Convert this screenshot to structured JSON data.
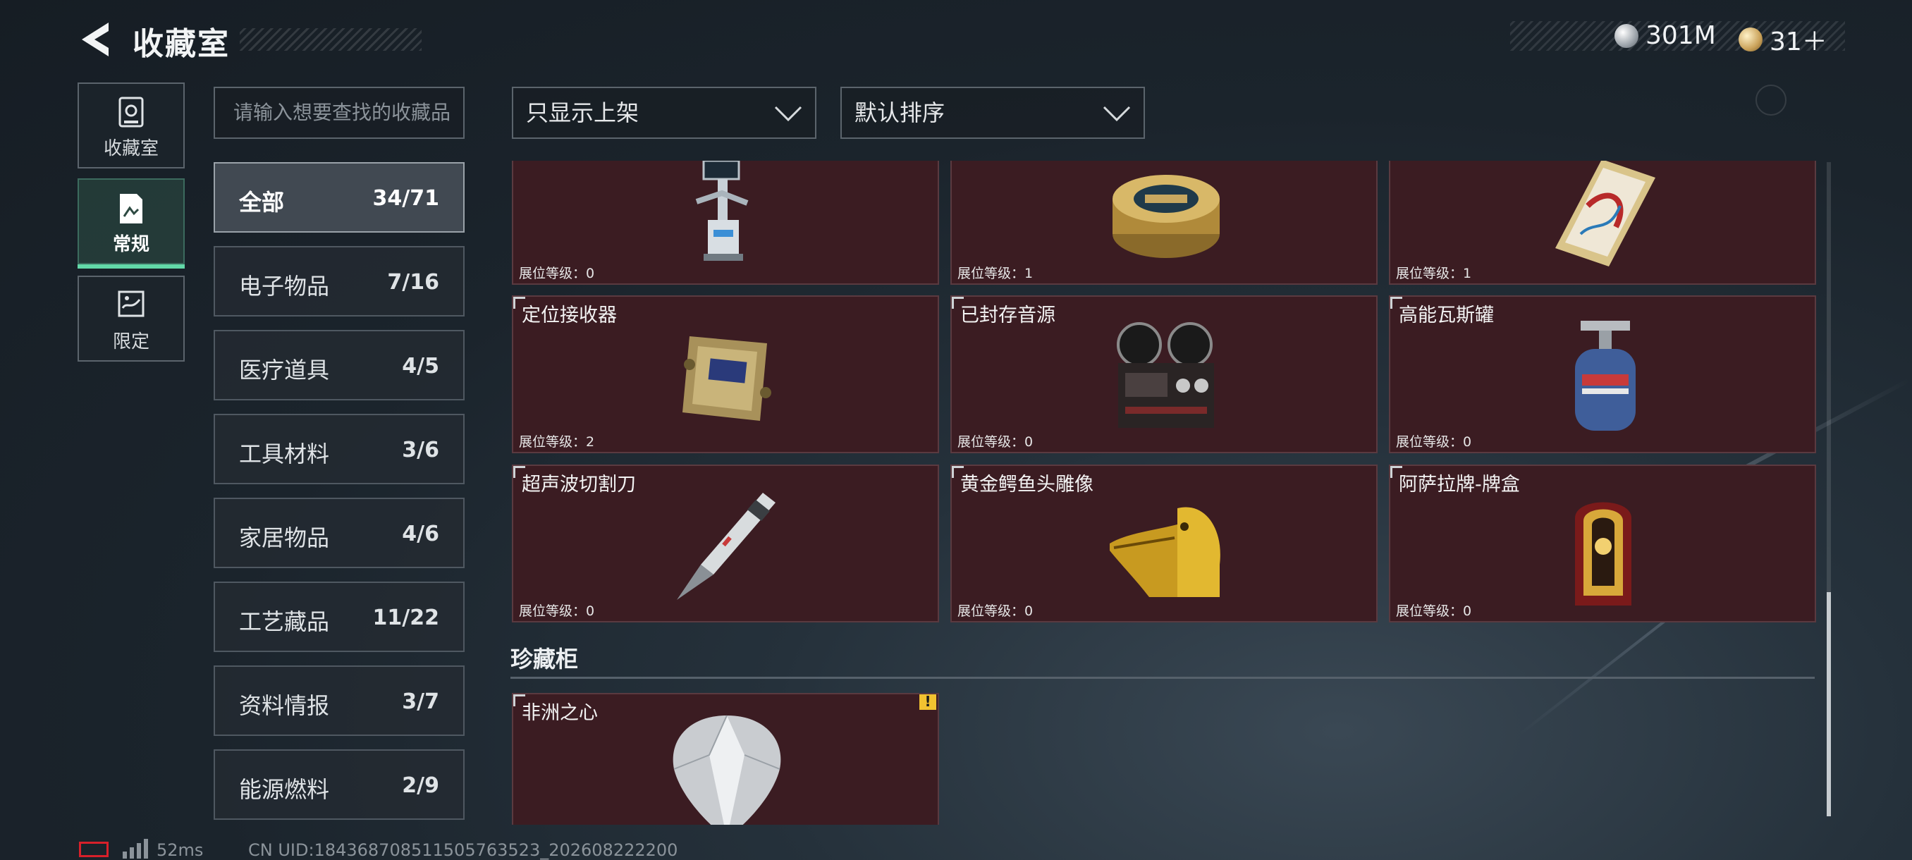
{
  "header": {
    "title": "收藏室"
  },
  "currency": [
    {
      "icon": "silver-coin-icon",
      "value": "301M"
    },
    {
      "icon": "gold-coin-icon",
      "value": "31＋"
    }
  ],
  "rail": [
    {
      "label": "收藏室",
      "icon": "vault-icon",
      "active": false
    },
    {
      "label": "常规",
      "icon": "document-icon",
      "active": true
    },
    {
      "label": "限定",
      "icon": "limited-icon",
      "active": false
    }
  ],
  "search": {
    "placeholder": "请输入想要查找的收藏品"
  },
  "filters": {
    "shelf": "只显示上架",
    "sort": "默认排序"
  },
  "categories": [
    {
      "name": "全部",
      "count": "34/71"
    },
    {
      "name": "电子物品",
      "count": "7/16"
    },
    {
      "name": "医疗道具",
      "count": "4/5"
    },
    {
      "name": "工具材料",
      "count": "3/6"
    },
    {
      "name": "家居物品",
      "count": "4/6"
    },
    {
      "name": "工艺藏品",
      "count": "11/22"
    },
    {
      "name": "资料情报",
      "count": "3/7"
    },
    {
      "name": "能源燃料",
      "count": "2/9"
    }
  ],
  "items": [
    {
      "name": "",
      "level": "展位等级：0",
      "icon": "surgical-robot-icon"
    },
    {
      "name": "",
      "level": "展位等级：1",
      "icon": "caviar-tin-icon"
    },
    {
      "name": "",
      "level": "展位等级：1",
      "icon": "ornate-card-icon"
    },
    {
      "name": "定位接收器",
      "level": "展位等级：2",
      "icon": "gps-receiver-icon"
    },
    {
      "name": "已封存音源",
      "level": "展位等级：0",
      "icon": "reel-to-reel-recorder-icon"
    },
    {
      "name": "高能瓦斯罐",
      "level": "展位等级：0",
      "icon": "gas-canister-icon"
    },
    {
      "name": "超声波切割刀",
      "level": "展位等级：0",
      "icon": "ultrasonic-knife-icon"
    },
    {
      "name": "黄金鳄鱼头雕像",
      "level": "展位等级：0",
      "icon": "gold-crocodile-head-icon"
    },
    {
      "name": "阿萨拉牌-牌盒",
      "level": "展位等级：0",
      "icon": "card-box-icon"
    }
  ],
  "cabinet": {
    "title": "珍藏柜",
    "items": [
      {
        "name": "非洲之心",
        "warning": "!",
        "icon": "diamond-icon"
      }
    ]
  },
  "footer": {
    "ping": "52ms",
    "uid": "CN UID:1843687085115057635​23_202608222200"
  }
}
